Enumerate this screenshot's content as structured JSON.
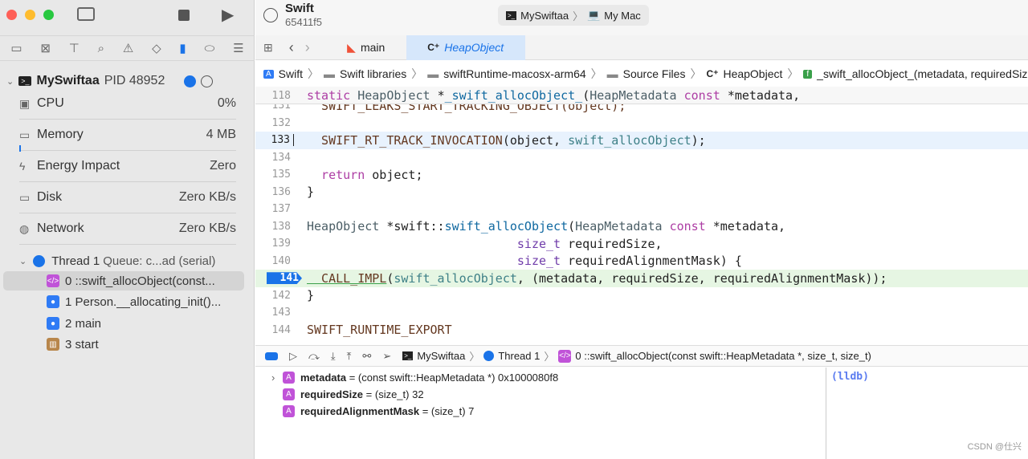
{
  "window": {
    "scheme": "Swift",
    "commit": "65411f5",
    "destination_target": "MySwiftaa",
    "destination_device": "My Mac"
  },
  "tabs": [
    {
      "label": "main",
      "icon": "swift-icon"
    },
    {
      "label": "HeapObject",
      "icon": "cpp-file-icon",
      "active": true
    }
  ],
  "breadcrumb": [
    "Swift",
    "Swift libraries",
    "swiftRuntime-macosx-arm64",
    "Source Files",
    "HeapObject",
    "_swift_allocObject_(metadata, requiredSize, r"
  ],
  "process": {
    "name": "MySwiftaa",
    "pid": "PID 48952"
  },
  "gauges": [
    {
      "label": "CPU",
      "value": "0%",
      "icon": "cpu-icon"
    },
    {
      "label": "Memory",
      "value": "4 MB",
      "icon": "memory-icon"
    },
    {
      "label": "Energy Impact",
      "value": "Zero",
      "icon": "bolt-icon"
    },
    {
      "label": "Disk",
      "value": "Zero KB/s",
      "icon": "disk-icon"
    },
    {
      "label": "Network",
      "value": "Zero KB/s",
      "icon": "globe-icon"
    }
  ],
  "thread": {
    "label": "Thread 1",
    "queue": "Queue: c...ad (serial)"
  },
  "frames": [
    {
      "label": "0 ::swift_allocObject(const...",
      "color": "#c053d8"
    },
    {
      "label": "1 Person.__allocating_init()...",
      "color": "#2f7bf5"
    },
    {
      "label": "2 main",
      "color": "#2f7bf5"
    },
    {
      "label": "3 start",
      "color": "#b8864b"
    }
  ],
  "code": {
    "sticky": {
      "num": "118",
      "tokens": [
        [
          "static ",
          "kw"
        ],
        [
          "HeapObject ",
          "cl"
        ],
        [
          "*",
          "pl"
        ],
        [
          "_swift_allocObject_",
          "def"
        ],
        [
          "(",
          "pl"
        ],
        [
          "HeapMetadata ",
          "cl"
        ],
        [
          "const ",
          "kw"
        ],
        [
          "*metadata,",
          "pl"
        ]
      ]
    },
    "lines": [
      {
        "num": "131",
        "tokens": [
          [
            "  SWIFT_LEAKS_START_TRACKING_OBJECT(object);",
            "mc"
          ]
        ]
      },
      {
        "num": "132",
        "tokens": []
      },
      {
        "num": "133",
        "tokens": [
          [
            "  SWIFT_RT_TRACK_INVOCATION",
            "mc"
          ],
          [
            "(object, ",
            "pl"
          ],
          [
            "swift_allocObject",
            "fn"
          ],
          [
            ");",
            "pl"
          ]
        ],
        "current": true
      },
      {
        "num": "134",
        "tokens": []
      },
      {
        "num": "135",
        "tokens": [
          [
            "  return ",
            "kw"
          ],
          [
            "object;",
            "pl"
          ]
        ]
      },
      {
        "num": "136",
        "tokens": [
          [
            "}",
            "pl"
          ]
        ]
      },
      {
        "num": "137",
        "tokens": []
      },
      {
        "num": "138",
        "tokens": [
          [
            "HeapObject ",
            "cl"
          ],
          [
            "*swift::",
            "pl"
          ],
          [
            "swift_allocObject",
            "def"
          ],
          [
            "(",
            "pl"
          ],
          [
            "HeapMetadata ",
            "cl"
          ],
          [
            "const ",
            "kw"
          ],
          [
            "*metadata,",
            "pl"
          ]
        ]
      },
      {
        "num": "139",
        "tokens": [
          [
            "                             size_t ",
            "ty"
          ],
          [
            "requiredSize,",
            "pl"
          ]
        ]
      },
      {
        "num": "140",
        "tokens": [
          [
            "                             size_t ",
            "ty"
          ],
          [
            "requiredAlignmentMask) {",
            "pl"
          ]
        ]
      },
      {
        "num": "141",
        "tokens": [
          [
            "  CALL_IMPL",
            "mc"
          ],
          [
            "(",
            "pl"
          ],
          [
            "swift_allocObject",
            "fn"
          ],
          [
            ", (metadata, requiredSize, requiredAlignmentMask));",
            "pl"
          ]
        ],
        "breakpoint": true
      },
      {
        "num": "142",
        "tokens": [
          [
            "}",
            "pl"
          ]
        ]
      },
      {
        "num": "143",
        "tokens": []
      },
      {
        "num": "144",
        "tokens": [
          [
            "SWIFT_RUNTIME_EXPORT",
            "mc"
          ]
        ]
      }
    ]
  },
  "debugbar": {
    "target": "MySwiftaa",
    "thread": "Thread 1",
    "frame": "0 ::swift_allocObject(const swift::HeapMetadata *, size_t, size_t)"
  },
  "variables": [
    {
      "name": "metadata",
      "value": "= (const swift::HeapMetadata *) 0x1000080f8",
      "expandable": true
    },
    {
      "name": "requiredSize",
      "value": "= (size_t) 32"
    },
    {
      "name": "requiredAlignmentMask",
      "value": "= (size_t) 7"
    }
  ],
  "console": {
    "prompt": "(lldb)"
  },
  "watermark": "CSDN @仕兴",
  "colors": {
    "accent": "#1a73e8",
    "breakpoint": "#1a73e8",
    "current_line": "#e8f2fd",
    "pc_line": "#e6f6e3"
  }
}
